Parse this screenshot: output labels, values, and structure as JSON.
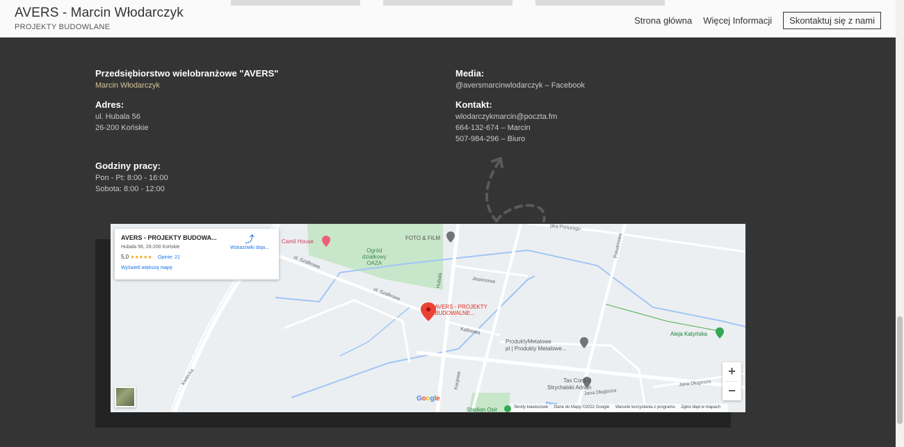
{
  "header": {
    "title": "AVERS - Marcin Włodarczyk",
    "subtitle": "PROJEKTY BUDOWLANE",
    "nav": [
      "Strona główna",
      "Więcej Informacji"
    ],
    "cta": "Skontaktuj się z nami"
  },
  "info": {
    "company": {
      "heading": "Przedsiębiorstwo wielobranżowe \"AVERS\"",
      "name": "Marcin Włodarczyk"
    },
    "address": {
      "heading": "Adres:",
      "line1": "ul. Hubala 56",
      "line2": "26-200 Końskie"
    },
    "hours": {
      "heading": "Godziny pracy:",
      "line1": "Pon - Pt: 8:00 - 16:00",
      "line2": "Sobota: 8:00 - 12:00"
    },
    "media": {
      "heading": "Media:",
      "line1": "@aversmarcinwlodarczyk – Facebook"
    },
    "contact": {
      "heading": "Kontakt:",
      "email": "wlodarczykmarcin@poczta.fm",
      "phone1": "664-132-674 – Marcin",
      "phone2": "507-984-296 – Biuro"
    }
  },
  "map": {
    "infobox": {
      "title": "AVERS - PROJEKTY BUDOWA...",
      "address": "Hubala 56, 26-200 Końskie",
      "rating": "5,0",
      "stars": "★★★★★",
      "reviews": "Opinie: 21",
      "more": "Wyświetl większą mapę",
      "directions": "Wskazówki doja..."
    },
    "labels": {
      "camil": "Camil House",
      "foto": "FOTO & FILM",
      "ogrod1": "Ogród",
      "ogrod2": "działkowy",
      "ogrod3": "OAZA",
      "avers1": "AVERS - PROJEKTY",
      "avers2": "BUDOWALNE...",
      "produkty1": "ProduktyMetalowe",
      "produkty2": "pl | Produkty Metalowe...",
      "tax1": "Tax Control",
      "tax2": "Strychalski Adrian",
      "aleja": "Aleja Katyńska",
      "stadion": "Stadion Osir",
      "dino": "Dino"
    },
    "streets": {
      "szafirowa1": "ul. Szafirowa",
      "szafirowa2": "ul. Szafirowa",
      "jesionowa": "Jesionowa",
      "kalinowa": "Kalinowa",
      "hubala": "Hubala",
      "poludniowa": "Południowa",
      "kielecka": "Kielecka",
      "jana_dlugosza1": "Jana Długosza",
      "jana_dlugosza2": "Jana Długosza",
      "kaczorowa": "Kacjowa",
      "ponurego": "pka-Ponurego"
    },
    "zoom_in": "+",
    "zoom_out": "−",
    "google": "Google",
    "attribution": [
      "Skróty klawiszowe",
      "Dane do Mapy ©2022 Google",
      "Warunki korzystania z programu",
      "Zgłoś błąd w mapach"
    ]
  },
  "colors": {
    "background": "#343434",
    "pin": "#ea4335",
    "park": "#c8e6c9",
    "water": "#9fc5f8"
  }
}
